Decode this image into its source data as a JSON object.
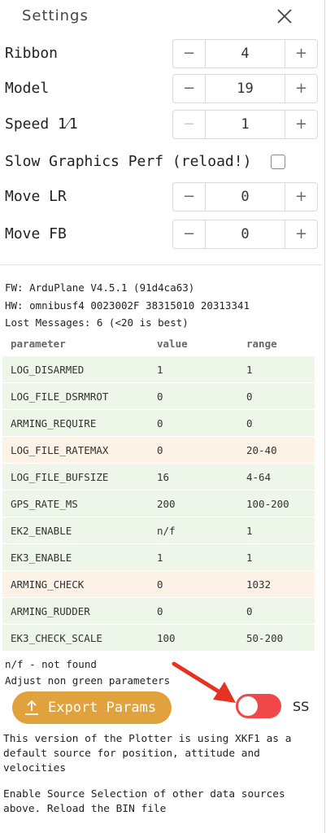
{
  "header": {
    "title": "Settings"
  },
  "settings": {
    "ribbon": {
      "label": "Ribbon",
      "value": "4",
      "minus": "−",
      "plus": "+"
    },
    "model": {
      "label": "Model",
      "value": "19",
      "minus": "−",
      "plus": "+"
    },
    "speed": {
      "label": "Speed 1⁄1",
      "value": "1",
      "minus": "−",
      "plus": "+"
    },
    "slow_graphics": {
      "label": "Slow Graphics Perf (reload!)",
      "checked": false
    },
    "move_lr": {
      "label": "Move LR",
      "value": "0",
      "minus": "−",
      "plus": "+"
    },
    "move_fb": {
      "label": "Move FB",
      "value": "0",
      "minus": "−",
      "plus": "+"
    }
  },
  "info": {
    "fw": "FW: ArduPlane V4.5.1 (91d4ca63)",
    "hw": "HW: omnibusf4 0023002F 38315010 20313341",
    "lost": "Lost Messages: 6 (<20 is best)"
  },
  "params_table": {
    "headers": [
      "parameter",
      "value",
      "range"
    ],
    "rows": [
      {
        "parameter": "LOG_DISARMED",
        "value": "1",
        "range": "1",
        "ok": true
      },
      {
        "parameter": "LOG_FILE_DSRMROT",
        "value": "0",
        "range": "0",
        "ok": true
      },
      {
        "parameter": "ARMING_REQUIRE",
        "value": "0",
        "range": "0",
        "ok": true
      },
      {
        "parameter": "LOG_FILE_RATEMAX",
        "value": "0",
        "range": "20-40",
        "ok": false
      },
      {
        "parameter": "LOG_FILE_BUFSIZE",
        "value": "16",
        "range": "4-64",
        "ok": true
      },
      {
        "parameter": "GPS_RATE_MS",
        "value": "200",
        "range": "100-200",
        "ok": true
      },
      {
        "parameter": "EK2_ENABLE",
        "value": "n/f",
        "range": "1",
        "ok": true
      },
      {
        "parameter": "EK3_ENABLE",
        "value": "1",
        "range": "1",
        "ok": true
      },
      {
        "parameter": "ARMING_CHECK",
        "value": "0",
        "range": "1032",
        "ok": false
      },
      {
        "parameter": "ARMING_RUDDER",
        "value": "0",
        "range": "0",
        "ok": true
      },
      {
        "parameter": "EK3_CHECK_SCALE",
        "value": "100",
        "range": "50-200",
        "ok": true
      }
    ]
  },
  "footnotes": {
    "not_found": "n/f - not found",
    "adjust": "Adjust non green parameters"
  },
  "actions": {
    "export_label": "Export Params",
    "toggle_on": true,
    "toggle_label": "SS"
  },
  "notes": {
    "xkf1": "This version of the Plotter is using XKF1 as a default source for position, attitude and velocities",
    "enable": "Enable Source Selection of other data sources above. Reload the BIN file"
  },
  "colors": {
    "ok_row": "#edf6e8",
    "bad_row": "#fdf2e6",
    "export_button": "#e0a23c",
    "toggle_on": "#f04848",
    "annotation_arrow": "#e53222"
  },
  "icons": [
    "close-icon",
    "export-icon",
    "arrow-annotation"
  ]
}
